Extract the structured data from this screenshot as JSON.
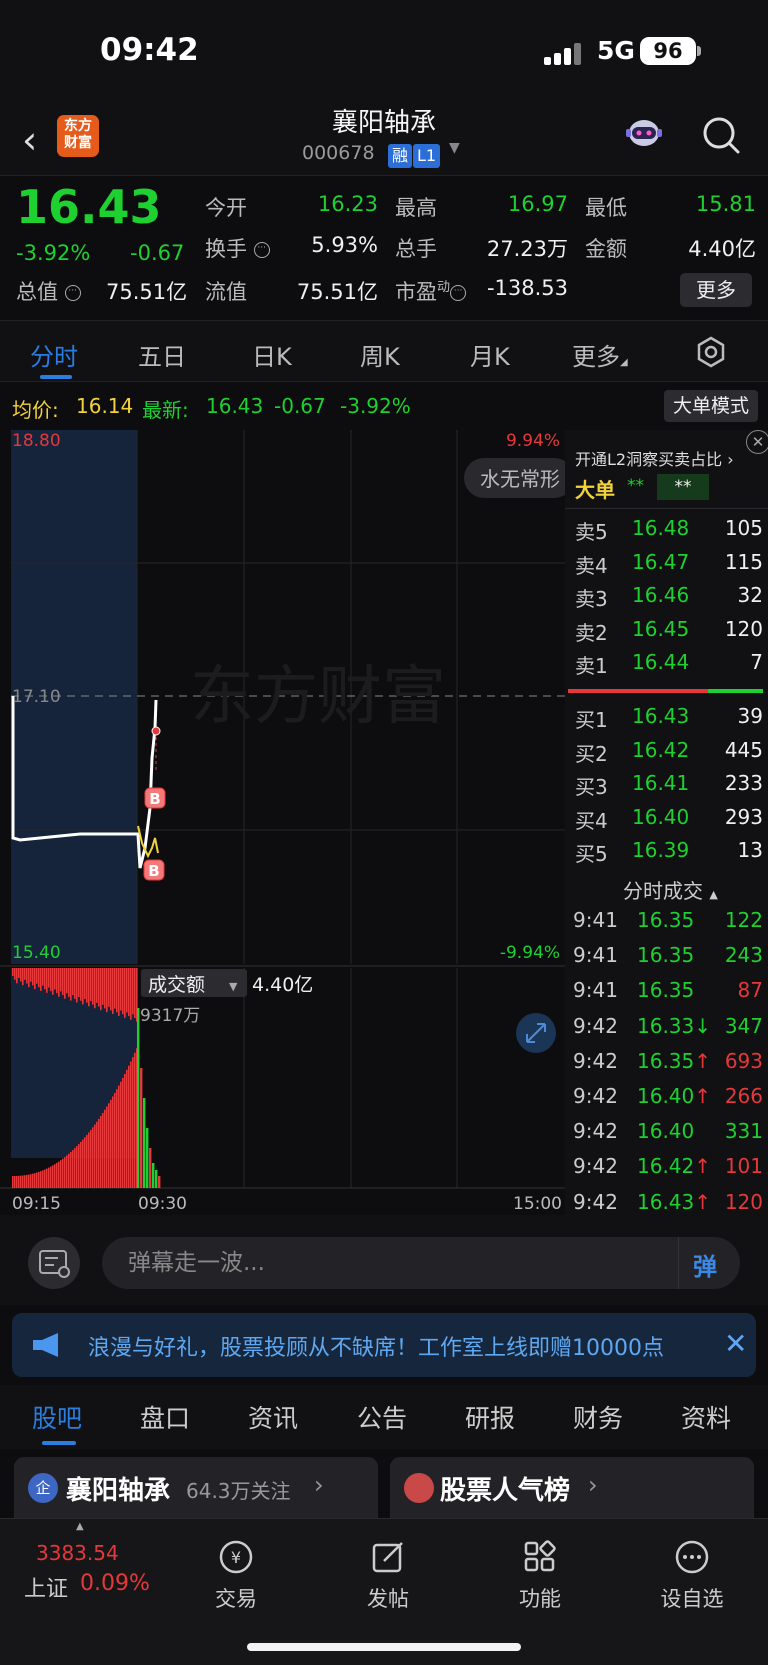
{
  "status_bar": {
    "time": "09:42",
    "network": "5G",
    "battery": "96"
  },
  "header": {
    "back_icon": "chevron-left-icon",
    "logo_text_1": "东方",
    "logo_text_2": "财富",
    "stock_name": "襄阳轴承",
    "stock_code": "000678",
    "tag_margin": "融",
    "tag_level": "L1",
    "robot_icon": "robot-icon",
    "search_icon": "search-icon"
  },
  "quote": {
    "price": "16.43",
    "change_pct": "-3.92%",
    "change": "-0.67",
    "open_label": "今开",
    "open_value": "16.23",
    "high_label": "最高",
    "high_value": "16.97",
    "low_label": "最低",
    "low_value": "15.81",
    "turnover_label": "换手",
    "turnover_value": "5.93%",
    "volume_label": "总手",
    "volume_value": "27.23万",
    "amount_label": "金额",
    "amount_value": "4.40亿",
    "mktcap_label": "总值",
    "mktcap_value": "75.51亿",
    "float_label": "流值",
    "float_value": "75.51亿",
    "pe_label": "市盈",
    "pe_sup": "动",
    "pe_value": "-138.53",
    "more_button": "更多"
  },
  "tabs": [
    "分时",
    "五日",
    "日K",
    "周K",
    "月K",
    "更多"
  ],
  "avg_line": {
    "avg_label": "均价:",
    "avg_value": "16.14",
    "latest_label": "最新:",
    "latest_value": "16.43",
    "latest_change": "-0.67",
    "latest_pct": "-3.92%",
    "big_order_button": "大单模式"
  },
  "chart": {
    "y_top": "18.80",
    "y_mid": "17.10",
    "y_bottom": "15.40",
    "pct_top": "9.94%",
    "pct_bottom": "-9.94%",
    "watermark": "东方财富",
    "danmu": "水无常形",
    "buy_marker": "B",
    "volume_selector": "成交额",
    "volume_total": "4.40亿",
    "volume_max": "9317万",
    "time_start": "09:15",
    "time_mid": "09:30",
    "time_end": "15:00"
  },
  "order_book": {
    "promo": "开通L2洞察买卖占比",
    "big_order_label": "大单",
    "big_order_mask1": "**",
    "big_order_mask2": "**",
    "asks": [
      {
        "label": "卖5",
        "price": "16.48",
        "vol": "105"
      },
      {
        "label": "卖4",
        "price": "16.47",
        "vol": "115"
      },
      {
        "label": "卖3",
        "price": "16.46",
        "vol": "32"
      },
      {
        "label": "卖2",
        "price": "16.45",
        "vol": "120"
      },
      {
        "label": "卖1",
        "price": "16.44",
        "vol": "7"
      }
    ],
    "bids": [
      {
        "label": "买1",
        "price": "16.43",
        "vol": "39"
      },
      {
        "label": "买2",
        "price": "16.42",
        "vol": "445"
      },
      {
        "label": "买3",
        "price": "16.41",
        "vol": "233"
      },
      {
        "label": "买4",
        "price": "16.40",
        "vol": "293"
      },
      {
        "label": "买5",
        "price": "16.39",
        "vol": "13"
      }
    ],
    "ticks_title": "分时成交",
    "ticks": [
      {
        "time": "9:41",
        "price": "16.35",
        "arrow": "",
        "vol": "122",
        "pc": "#1ed030",
        "vc": "#1ed030"
      },
      {
        "time": "9:41",
        "price": "16.35",
        "arrow": "",
        "vol": "243",
        "pc": "#1ed030",
        "vc": "#1ed030"
      },
      {
        "time": "9:41",
        "price": "16.35",
        "arrow": "",
        "vol": "87",
        "pc": "#1ed030",
        "vc": "#e5383b"
      },
      {
        "time": "9:42",
        "price": "16.33",
        "arrow": "↓",
        "vol": "347",
        "pc": "#1ed030",
        "vc": "#1ed030"
      },
      {
        "time": "9:42",
        "price": "16.35",
        "arrow": "↑",
        "vol": "693",
        "pc": "#1ed030",
        "vc": "#e5383b"
      },
      {
        "time": "9:42",
        "price": "16.40",
        "arrow": "↑",
        "vol": "266",
        "pc": "#1ed030",
        "vc": "#e5383b"
      },
      {
        "time": "9:42",
        "price": "16.40",
        "arrow": "",
        "vol": "331",
        "pc": "#1ed030",
        "vc": "#1ed030"
      },
      {
        "time": "9:42",
        "price": "16.42",
        "arrow": "↑",
        "vol": "101",
        "pc": "#1ed030",
        "vc": "#e5383b"
      },
      {
        "time": "9:42",
        "price": "16.43",
        "arrow": "↑",
        "vol": "120",
        "pc": "#1ed030",
        "vc": "#e5383b"
      }
    ]
  },
  "danmu_bar": {
    "placeholder": "弹幕走一波...",
    "send_label": "弹"
  },
  "notice": {
    "text": "浪漫与好礼，股票投顾从不缺席！工作室上线即赠10000点"
  },
  "sub_tabs": [
    "股吧",
    "盘口",
    "资讯",
    "公告",
    "研报",
    "财务",
    "资料"
  ],
  "cards": [
    {
      "badge": "企",
      "title": "襄阳轴承",
      "sub": "64.3万关注"
    },
    {
      "title": "股票人气榜"
    }
  ],
  "bottom_nav": {
    "index_value": "3383.54",
    "index_name": "上证",
    "index_pct": "0.09%",
    "items": [
      {
        "label": "交易",
        "icon": "trade-icon"
      },
      {
        "label": "发帖",
        "icon": "edit-icon"
      },
      {
        "label": "功能",
        "icon": "grid-icon"
      },
      {
        "label": "设自选",
        "icon": "more-icon"
      }
    ]
  },
  "colors": {
    "up": "#e5383b",
    "down": "#1ed030",
    "accent": "#2a7de1",
    "avg": "#f2d33a"
  }
}
